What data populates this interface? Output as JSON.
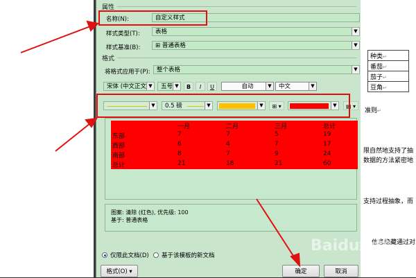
{
  "dialog": {
    "section_properties": "属性",
    "name_label": "名称(N):",
    "name_value": "自定义样式",
    "style_type_label": "样式类型(T):",
    "style_type_value": "表格",
    "style_base_label": "样式基准(B):",
    "style_base_value": "⊞ 普通表格",
    "section_format": "格式",
    "apply_to_label": "将格式应用于(P):",
    "apply_to_value": "整个表格",
    "font_value": "宋体 (中文正文)",
    "size_value": "五号",
    "bold": "B",
    "italic": "I",
    "underline": "U",
    "font_color_value": "自动",
    "lang_value": "中文",
    "border_width_value": "0.5 磅",
    "shading_color": "#ffc000",
    "cell_fill_color": "#ff0000",
    "preview": {
      "headers": [
        "一月",
        "二月",
        "三月",
        "总计"
      ],
      "rows": [
        {
          "label": "东部",
          "values": [
            "7",
            "7",
            "5",
            "19"
          ]
        },
        {
          "label": "西部",
          "values": [
            "6",
            "4",
            "7",
            "17"
          ]
        },
        {
          "label": "南部",
          "values": [
            "8",
            "7",
            "9",
            "24"
          ]
        },
        {
          "label": "总计",
          "values": [
            "21",
            "18",
            "21",
            "60"
          ]
        }
      ]
    },
    "desc_line1": "图案: 清除 (红色), 优先级: 100",
    "desc_line2": "基于: 普通表格",
    "radio_this_doc": "仅限此文档(D)",
    "radio_new_docs": "基于该模板的新文档",
    "format_button": "格式(O) ▾",
    "ok_button": "确定",
    "cancel_button": "取消"
  },
  "document": {
    "table_cells": [
      "种类",
      "番茄",
      "茄子",
      "豆角"
    ],
    "text1": "准则",
    "text2": "限自然地支持了抽",
    "text3": "数据的方法紧密地",
    "text4": "支持过程抽象，而",
    "text5": "信息隐藏通过对",
    "return_mark": "↵"
  },
  "watermark": "Baidu经验"
}
